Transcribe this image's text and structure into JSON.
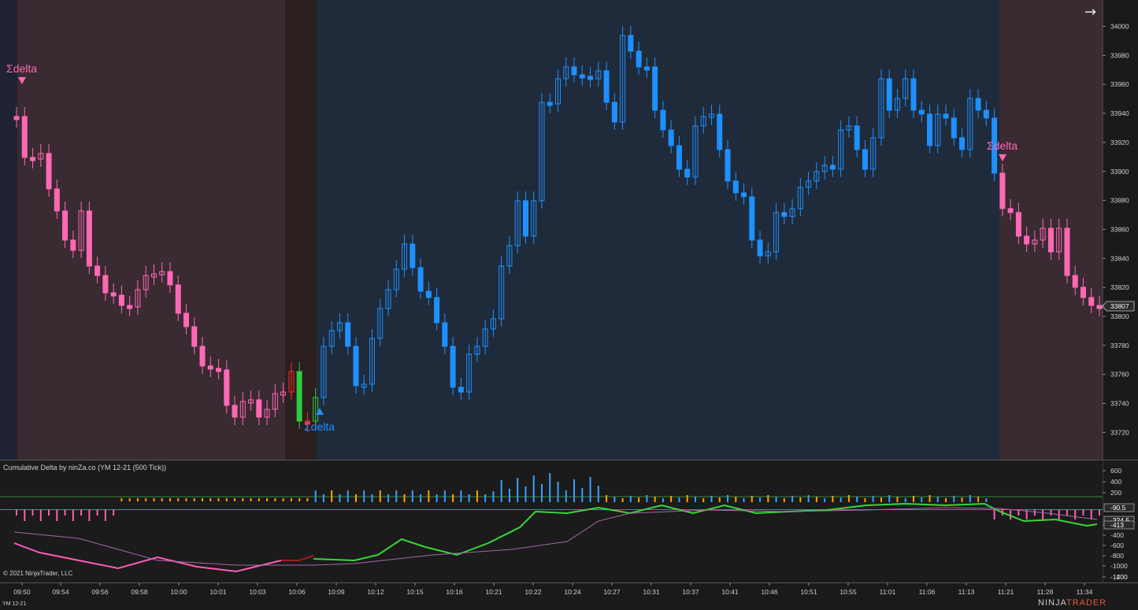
{
  "indicator_title": "Cumulative Delta by ninZa.co (YM 12-21 (500 Tick))",
  "copyright": "© 2021 NinjaTrader, LLC",
  "instrument": "YM 12-21",
  "logo": {
    "main": "NINJA",
    "accent": "TRADER"
  },
  "nav_icon": "arrow-right-icon",
  "price_axis": {
    "labels": [
      "34000",
      "33980",
      "33960",
      "33940",
      "33920",
      "33900",
      "33880",
      "33860",
      "33840",
      "33820",
      "33800",
      "33780",
      "33760",
      "33740",
      "33720"
    ],
    "current_price": "33807"
  },
  "delta_axis": {
    "labels": [
      "600",
      "400",
      "200",
      "-200",
      "-400",
      "-600",
      "-800",
      "-1000",
      "-1200",
      "-1400"
    ],
    "marker_1": "-90.5",
    "marker_2": "-324.5",
    "marker_3": "-413"
  },
  "time_axis": [
    "09:50",
    "09:54",
    "09:56",
    "09:58",
    "10:00",
    "10:01",
    "10:03",
    "10:06",
    "10:09",
    "10:12",
    "10:15",
    "10:16",
    "10:21",
    "10:22",
    "10:24",
    "10:27",
    "10:31",
    "10:37",
    "10:41",
    "10:46",
    "10:51",
    "10:55",
    "11:01",
    "11:06",
    "11:13",
    "11:21",
    "11:28",
    "11:34"
  ],
  "signals": [
    {
      "label": "Σdelta",
      "direction": "down",
      "color": "#ff69b4"
    },
    {
      "label": "Σdelta",
      "direction": "up",
      "color": "#1e90ff"
    },
    {
      "label": "Σdelta",
      "direction": "down",
      "color": "#ff69b4"
    }
  ],
  "colors": {
    "bear_fill": "#ff69b4",
    "bull_fill": "#1e90ff",
    "bear_zone": "#3a2a32",
    "bull_zone": "#1f2a3a",
    "neutral_zone": "#2a1f1f",
    "cum_delta": "#39d63a",
    "cum_delta_bear": "#ff5cb8",
    "delta_bull_bar": "#3aa0ff",
    "delta_bear_bar": "#ff5cb8",
    "delta_small_bar": "#ffa500"
  }
}
